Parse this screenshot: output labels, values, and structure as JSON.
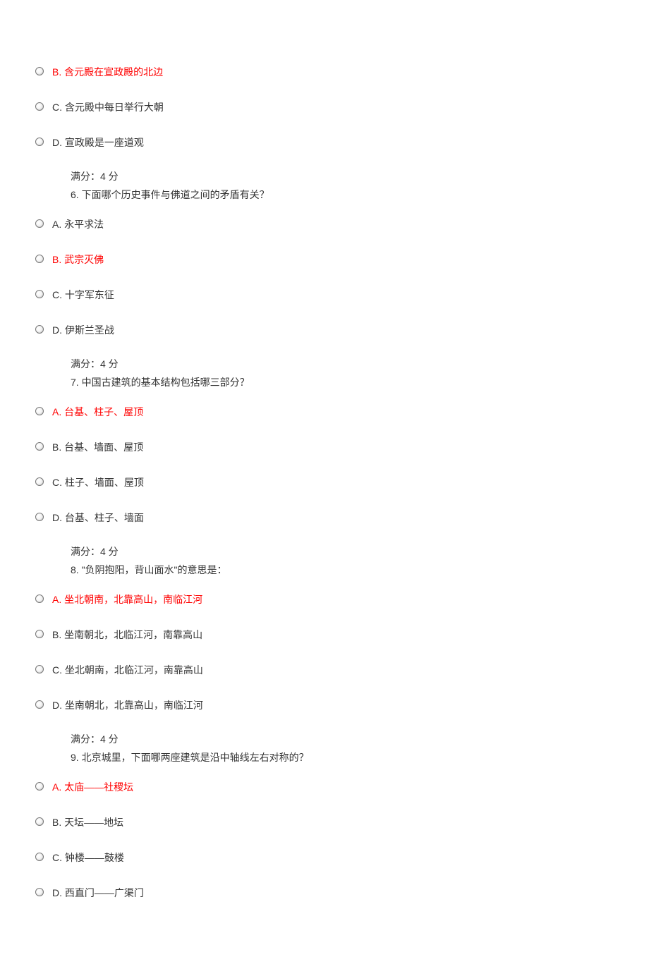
{
  "full_score_label": "满分：4 分",
  "q5": {
    "opts": [
      {
        "label": "B. 含元殿在宣政殿的北边",
        "answer": true
      },
      {
        "label": "C. 含元殿中每日举行大朝",
        "answer": false
      },
      {
        "label": "D. 宣政殿是一座道观",
        "answer": false
      }
    ]
  },
  "q6": {
    "question": "6.  下面哪个历史事件与佛道之间的矛盾有关？",
    "opts": [
      {
        "label": "A. 永平求法",
        "answer": false
      },
      {
        "label": "B. 武宗灭佛",
        "answer": true
      },
      {
        "label": "C. 十字军东征",
        "answer": false
      },
      {
        "label": "D. 伊斯兰圣战",
        "answer": false
      }
    ]
  },
  "q7": {
    "question": "7.  中国古建筑的基本结构包括哪三部分？",
    "opts": [
      {
        "label": "A. 台基、柱子、屋顶",
        "answer": true
      },
      {
        "label": "B. 台基、墙面、屋顶",
        "answer": false
      },
      {
        "label": "C. 柱子、墙面、屋顶",
        "answer": false
      },
      {
        "label": "D. 台基、柱子、墙面",
        "answer": false
      }
    ]
  },
  "q8": {
    "question": "8.  \"负阴抱阳，背山面水\"的意思是：",
    "opts": [
      {
        "label": "A. 坐北朝南，北靠高山，南临江河",
        "answer": true
      },
      {
        "label": "B. 坐南朝北，北临江河，南靠高山",
        "answer": false
      },
      {
        "label": "C. 坐北朝南，北临江河，南靠高山",
        "answer": false
      },
      {
        "label": "D. 坐南朝北，北靠高山，南临江河",
        "answer": false
      }
    ]
  },
  "q9": {
    "question": "9.  北京城里，下面哪两座建筑是沿中轴线左右对称的？",
    "opts": [
      {
        "label": "A. 太庙——社稷坛",
        "answer": true
      },
      {
        "label": "B. 天坛——地坛",
        "answer": false
      },
      {
        "label": "C. 钟楼——鼓楼",
        "answer": false
      },
      {
        "label": "D. 西直门——广渠门",
        "answer": false
      }
    ]
  }
}
